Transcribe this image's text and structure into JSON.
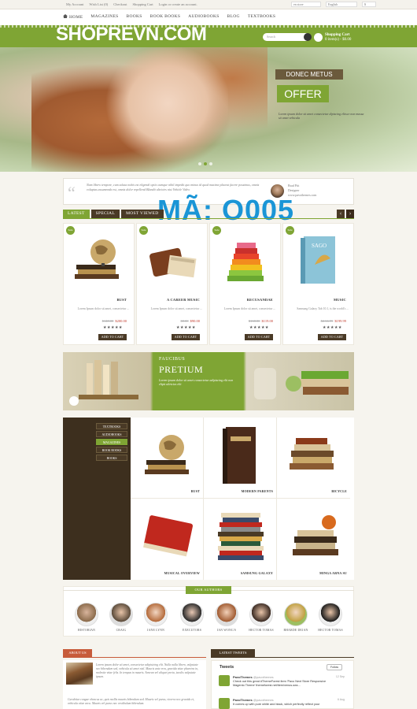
{
  "topbar": {
    "links": [
      "My Account",
      "Wish List (0)",
      "Checkout",
      "Shopping Cart",
      "Login or create an account."
    ],
    "selects": [
      "en store",
      "English",
      "$"
    ]
  },
  "nav": {
    "items": [
      "HOME",
      "MAGAZINES",
      "BOOKS",
      "BOOK BOOKS",
      "AUDIOBOOKS",
      "BLOG",
      "TEXTBOOKS"
    ]
  },
  "header": {
    "logo": "SHOPREVN.COM",
    "search_placeholder": "Search",
    "cart_title": "Shopping Cart",
    "cart_summary": "0 item(s) - $0.00"
  },
  "hero": {
    "tag": "DONEC METUS",
    "title": "OFFER",
    "desc": "Lorem ipsum dolor sit amet consectetur dipiscing elitsce non massa sit amet vehicula"
  },
  "testimonial": {
    "text": "Nam libero tempore, cum soluta nobis est eligendi optio cumque nihil impedit quo minus id quod maxime placeat facere possimus, omnis voluptas assumenda est, omnis dolor repellend Blandit ultricies nisi Vehicle Video",
    "name": "Brad Pitt",
    "role": "Designer",
    "site": "www.pavothemes.com"
  },
  "watermark": "MÃ: O005",
  "tabs": [
    "LATEST",
    "SPECIAL",
    "MOST VIEWED"
  ],
  "products": [
    {
      "sale": "Sale",
      "name": "BUST",
      "desc": "Lorem Ipsum dolor sit amet, consectetur ...",
      "old": "$148.00",
      "price": "$200.00",
      "stars": "★★★★★",
      "btn": "ADD TO CART"
    },
    {
      "sale": "Sale",
      "name": "A CAREER MUSIC",
      "desc": "Lorem Ipsum dolor sit amet, consectetur ...",
      "old": "$0.00",
      "price": "$90.00",
      "stars": "★★★★★",
      "btn": "ADD TO CART"
    },
    {
      "sale": "Sale",
      "name": "RECUSANDAE",
      "desc": "Lorem Ipsum dolor sit amet, consectetur ...",
      "old": "$168.00",
      "price": "$119.00",
      "stars": "★★★★★",
      "btn": "ADD TO CART"
    },
    {
      "sale": "Sale",
      "name": "MUSIC",
      "desc": "Samsung Galaxy Tab 10.1, is the world's ...",
      "old": "$2.66.99",
      "price": "$199.99",
      "stars": "★★★★★",
      "btn": "ADD TO CART"
    }
  ],
  "banner": {
    "tag": "FAUCIBUS",
    "title": "PRETIUM",
    "desc": "Lorem ipsum dolor sit amet consectetur adipiscing elit non elipit ultricies elit"
  },
  "category_menu": [
    "TEXTBOOKS",
    "AUDIOBOOKS",
    "MAGAZINES",
    "BOOK BOOKS",
    "BOOKS"
  ],
  "category_products": [
    "BUST",
    "MODERN PARENTS",
    "BICYCLE",
    "MUSICAL OVERVIEW",
    "SAMSUNG GALAXY",
    "MINGA ARNA SU"
  ],
  "authors": {
    "title": "OUR AUTHORS",
    "list": [
      "HISTORIAN",
      "CRAIG",
      "JANE LYNN",
      "EXECUTORS",
      "IAN WONG'S",
      "HECTOR TOMAS",
      "BHARDE DEJAN",
      "HECTOR TOMAS"
    ]
  },
  "about": {
    "title": "ABOUT US",
    "text": "Lorem ipsum dolor sit amet, consectetur adipisicing elit. Nulla nulla libero, vulputate nec bibendum sed, vehicula sit amet nisl. Mauris ante eros, gravida vitae pharetra in, molestie vitae felis. In tempus in mauris. Aenean vel aliquet porta, iaculis vulputate ipsum.",
    "text2": "Curabitur congue rhoncus ac, quis mollis mauris bibendum sed. Mauris vel purus, viverra nec gravida et, vehicula vitae arcu. Mauris vel purus nec vestibulum bibendum."
  },
  "tweets": {
    "title": "LATEST TWEETS",
    "widget_title": "Tweets",
    "follow": "Follow",
    "items": [
      {
        "name": "PavoThemes",
        "handle": "@pavothemes",
        "date": "12 Sep",
        "text": "Check out this great #ThemeForest item 'Pavo Next Store Responsive Magento Theme' themeforest.net/item/venus-sea..."
      },
      {
        "name": "PavoThemes",
        "handle": "@pavothemes",
        "date": "6 Aug",
        "text": "It comes up with pure white and black, which perfectly reflect your"
      }
    ]
  },
  "colors": {
    "accent": "#7fa534",
    "dark": "#4a3a26",
    "about": "#c75b3a",
    "watermark": "#1a95d6"
  }
}
